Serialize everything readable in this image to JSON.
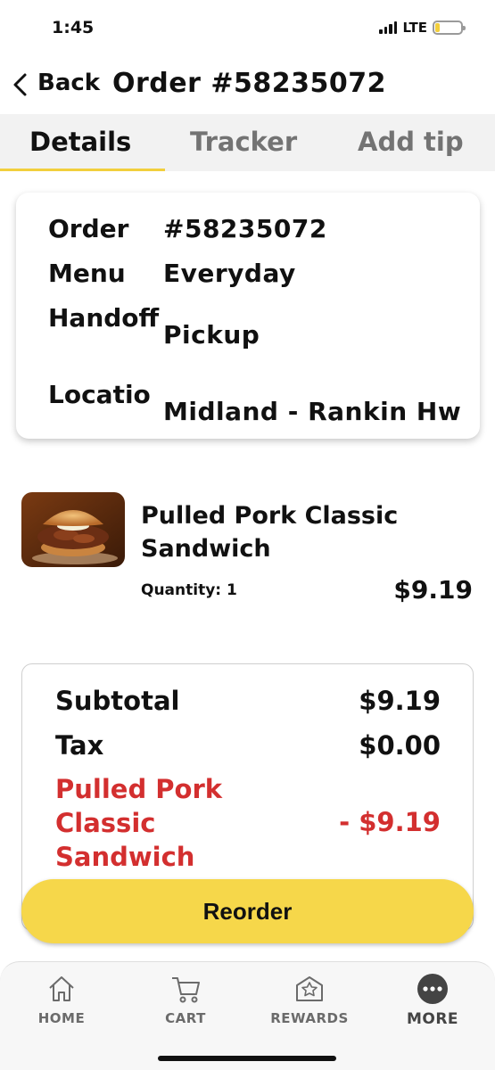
{
  "status_bar": {
    "time": "1:45",
    "network": "LTE",
    "battery_icon": "battery-low-icon"
  },
  "header": {
    "back_label": "Back",
    "title": "Order #58235072"
  },
  "tabs": [
    {
      "label": "Details",
      "active": true
    },
    {
      "label": "Tracker",
      "active": false
    },
    {
      "label": "Add tip",
      "active": false
    }
  ],
  "order_info": {
    "rows": [
      {
        "label": "Order",
        "value": "#58235072"
      },
      {
        "label": "Menu",
        "value": "Everyday"
      },
      {
        "label": "Handoff",
        "value": "Pickup"
      },
      {
        "label": "Location",
        "value": "Midland - Rankin Hw"
      }
    ]
  },
  "item": {
    "name": "Pulled Pork Classic Sandwich",
    "quantity": "Quantity: 1",
    "price": "$9.19"
  },
  "summary": {
    "subtotal_label": "Subtotal",
    "subtotal_value": "$9.19",
    "tax_label": "Tax",
    "tax_value": "$0.00",
    "discount_label": "Pulled Pork Classic Sandwich",
    "discount_value": "- $9.19"
  },
  "reorder_label": "Reorder",
  "bottom_nav": [
    {
      "label": "HOME",
      "icon": "home-icon"
    },
    {
      "label": "CART",
      "icon": "cart-icon"
    },
    {
      "label": "REWARDS",
      "icon": "rewards-icon"
    },
    {
      "label": "MORE",
      "icon": "more-icon",
      "active": true
    }
  ],
  "colors": {
    "accent_yellow": "#f6d74a",
    "discount_red": "#d32f2f",
    "tab_inactive": "#737373"
  }
}
